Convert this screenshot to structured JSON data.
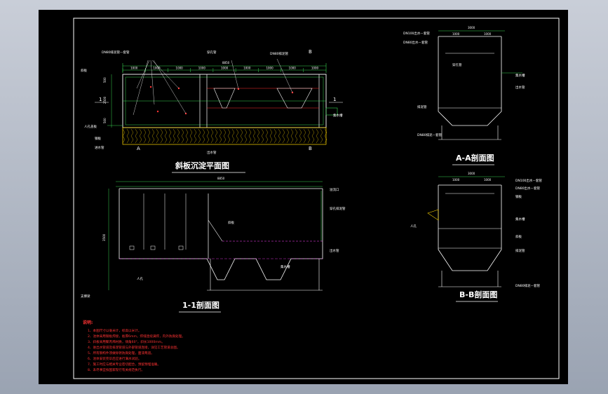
{
  "drawing": {
    "background": "#000000",
    "frame_color": "#ffffff",
    "line_green": "#39d353",
    "line_white": "#ffffff",
    "line_red": "#ff3333",
    "line_yellow": "#ffd700",
    "line_magenta": "#ff40ff"
  },
  "views": {
    "plan": {
      "title": "斜板沉淀平面图"
    },
    "section_11": {
      "title": "1-1剖面图"
    },
    "section_aa": {
      "title": "A-A剖面图"
    },
    "section_bb": {
      "title": "B-B剖面图"
    }
  },
  "section_marks": {
    "a": "A",
    "b": "B",
    "one": "1"
  },
  "plan_dims": {
    "total": "8850",
    "segments": [
      "1000",
      "1000",
      "1000",
      "1000",
      "1000",
      "1000",
      "1000",
      "1000",
      "1000"
    ],
    "left_height": [
      "500",
      "2500",
      "500"
    ]
  },
  "section11_dims": {
    "total": "8850",
    "height": "3500"
  },
  "aa_dims": {
    "total": "3000",
    "parts": [
      "1000",
      "1000"
    ]
  },
  "bb_dims": {
    "total": "3000",
    "parts": [
      "1000",
      "1000"
    ]
  },
  "plan_labels": [
    "DN80排泥管—套管",
    "穿孔管",
    "DN80排泥管",
    "斜板",
    "集水槽",
    "人孔盖板",
    "钢板",
    "进水管",
    "出水管"
  ],
  "section11_labels": [
    "溢流口",
    "斜板",
    "穿孔排泥管",
    "集水槽",
    "出水管",
    "人孔",
    "支撑梁"
  ],
  "aa_labels": [
    "DN100出水—套管",
    "DN80出水—套管",
    "穿孔管",
    "集水槽",
    "出水管",
    "排泥管",
    "DN80排泥—套管"
  ],
  "bb_labels": [
    "DN100出水—套管",
    "DN80出水—套管",
    "钢板",
    "人孔",
    "集水槽",
    "斜板",
    "排泥管",
    "DN80排泥—套管"
  ],
  "notes": {
    "heading": "说明:",
    "items": [
      "1、本图尺寸以毫米计，标高以米计。",
      "2、池体采用钢板焊接，板厚6mm，焊缝连续满焊，内外防腐处理。",
      "3、斜板采用聚丙烯材质，倾角60°，斜长1000mm。",
      "4、进出水管道及排泥管道与外部管道连接，详见工艺管道总图。",
      "5、所有钢构件须做除锈防腐处理，面漆两道。",
      "6、池体安装完毕后应进行满水试验。",
      "7、施工时应与相关专业密切配合，预留预埋准确。",
      "8、未尽事宜按国家现行有关规范执行。"
    ]
  }
}
